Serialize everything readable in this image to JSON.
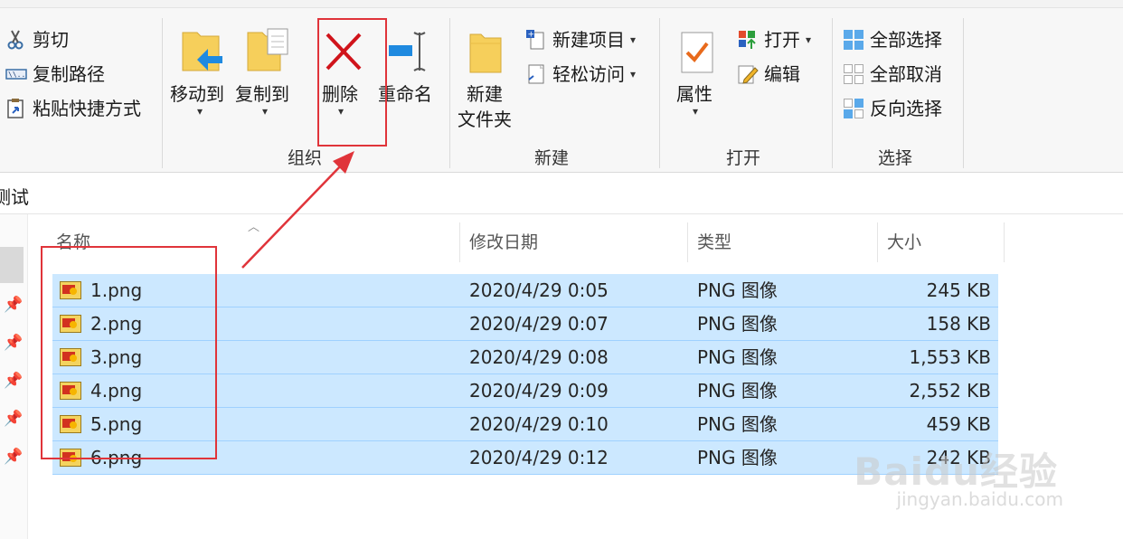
{
  "ribbon": {
    "clipboard": {
      "cut": "剪切",
      "copy_path": "复制路径",
      "paste_shortcut": "粘贴快捷方式"
    },
    "organize": {
      "label": "组织",
      "move_to": "移动到",
      "copy_to": "复制到",
      "delete": "删除",
      "rename": "重命名"
    },
    "new": {
      "label": "新建",
      "new_folder_line1": "新建",
      "new_folder_line2": "文件夹",
      "new_item": "新建项目",
      "easy_access": "轻松访问"
    },
    "open": {
      "label": "打开",
      "properties": "属性",
      "open": "打开",
      "edit": "编辑"
    },
    "select": {
      "label": "选择",
      "select_all": "全部选择",
      "select_none": "全部取消",
      "invert_selection": "反向选择"
    }
  },
  "address": {
    "text": "测试"
  },
  "file_list": {
    "columns": [
      "名称",
      "修改日期",
      "类型",
      "大小"
    ],
    "rows": [
      {
        "name": "1.png",
        "date": "2020/4/29 0:05",
        "type": "PNG 图像",
        "size": "245 KB"
      },
      {
        "name": "2.png",
        "date": "2020/4/29 0:07",
        "type": "PNG 图像",
        "size": "158 KB"
      },
      {
        "name": "3.png",
        "date": "2020/4/29 0:08",
        "type": "PNG 图像",
        "size": "1,553 KB"
      },
      {
        "name": "4.png",
        "date": "2020/4/29 0:09",
        "type": "PNG 图像",
        "size": "2,552 KB"
      },
      {
        "name": "5.png",
        "date": "2020/4/29 0:10",
        "type": "PNG 图像",
        "size": "459 KB"
      },
      {
        "name": "6.png",
        "date": "2020/4/29 0:12",
        "type": "PNG 图像",
        "size": "242 KB"
      }
    ]
  },
  "watermark": {
    "brand": "Baidu经验",
    "url": "jingyan.baidu.com"
  },
  "colors": {
    "selection": "#cce8ff",
    "annotation_red": "#e0343a",
    "delete_red": "#d0141b"
  }
}
